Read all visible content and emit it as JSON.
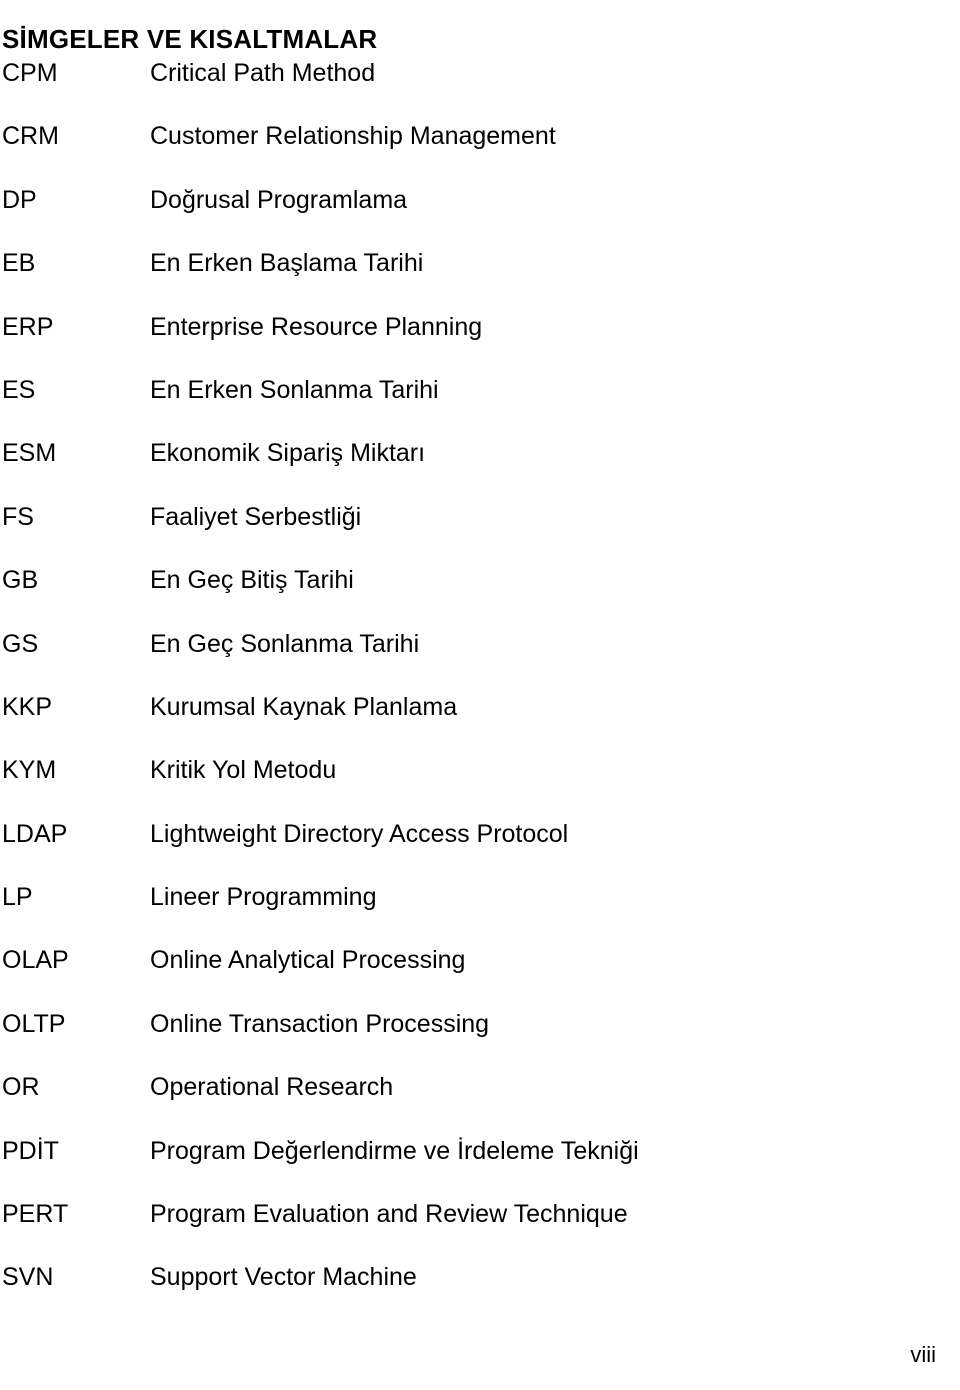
{
  "document": {
    "heading": "SİMGELER VE KISALTMALAR",
    "footer_page_number": "viii",
    "entries": [
      {
        "term": "CPM",
        "definition": "Critical Path Method"
      },
      {
        "term": "CRM",
        "definition": "Customer Relationship Management"
      },
      {
        "term": "DP",
        "definition": "Doğrusal Programlama"
      },
      {
        "term": "EB",
        "definition": "En Erken Başlama Tarihi"
      },
      {
        "term": "ERP",
        "definition": "Enterprise Resource Planning"
      },
      {
        "term": "ES",
        "definition": "En Erken Sonlanma Tarihi"
      },
      {
        "term": "ESM",
        "definition": "Ekonomik Sipariş Miktarı"
      },
      {
        "term": "FS",
        "definition": "Faaliyet Serbestliği"
      },
      {
        "term": "GB",
        "definition": "En Geç Bitiş Tarihi"
      },
      {
        "term": "GS",
        "definition": "En Geç Sonlanma Tarihi"
      },
      {
        "term": "KKP",
        "definition": "Kurumsal Kaynak Planlama"
      },
      {
        "term": "KYM",
        "definition": "Kritik Yol Metodu"
      },
      {
        "term": "LDAP",
        "definition": "Lightweight Directory Access Protocol"
      },
      {
        "term": "LP",
        "definition": "Lineer Programming"
      },
      {
        "term": "OLAP",
        "definition": "Online Analytical Processing"
      },
      {
        "term": "OLTP",
        "definition": "Online Transaction Processing"
      },
      {
        "term": "OR",
        "definition": "Operational Research"
      },
      {
        "term": "PDİT",
        "definition": "Program Değerlendirme ve İrdeleme Tekniği"
      },
      {
        "term": "PERT",
        "definition": "Program Evaluation and Review Technique"
      },
      {
        "term": "SVN",
        "definition": "Support Vector Machine"
      }
    ]
  }
}
